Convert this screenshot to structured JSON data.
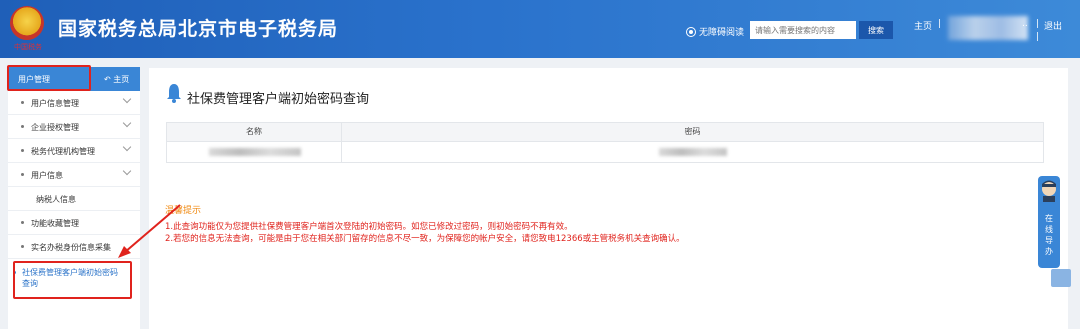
{
  "header": {
    "emblem_caption": "中国税务",
    "title": "国家税务总局北京市电子税务局",
    "accessibility_label": "无障碍阅读",
    "search": {
      "placeholder": "请输入需要搜索的内容",
      "button": "搜索"
    },
    "home_link": "主页",
    "separator": "|",
    "user_suffix": "..",
    "logout": "退出"
  },
  "sidebar": {
    "title": "用户管理",
    "home_link": "主页",
    "items": [
      {
        "label": "用户信息管理",
        "has_chevron": true
      },
      {
        "label": "企业授权管理",
        "has_chevron": true
      },
      {
        "label": "税务代理机构管理",
        "has_chevron": true
      },
      {
        "label": "用户信息",
        "has_chevron": true
      },
      {
        "label": "纳税人信息",
        "sub": true
      },
      {
        "label": "功能收藏管理",
        "has_chevron": false
      },
      {
        "label": "实名办税身份信息采集",
        "has_chevron": false
      }
    ],
    "active_item": "社保费管理客户端初始密码查询"
  },
  "main": {
    "page_title": "社保费管理客户端初始密码查询",
    "table": {
      "headers": [
        "名称",
        "密码"
      ]
    },
    "tips": {
      "title": "温馨提示",
      "lines": [
        "1.此查询功能仅为您提供社保费管理客户端首次登陆的初始密码。如您已修改过密码，则初始密码不再有效。",
        "2.若您的信息无法查询，可能是由于您在相关部门留存的信息不尽一致，为保障您的帐户安全，请您致电12366或主管税务机关查询确认。"
      ]
    }
  },
  "float_panel": {
    "label": "在线导办"
  },
  "colors": {
    "header_blue": "#2a72cc",
    "accent": "#3a86d6",
    "warning": "#e0231d",
    "tip_title": "#f08a12"
  }
}
